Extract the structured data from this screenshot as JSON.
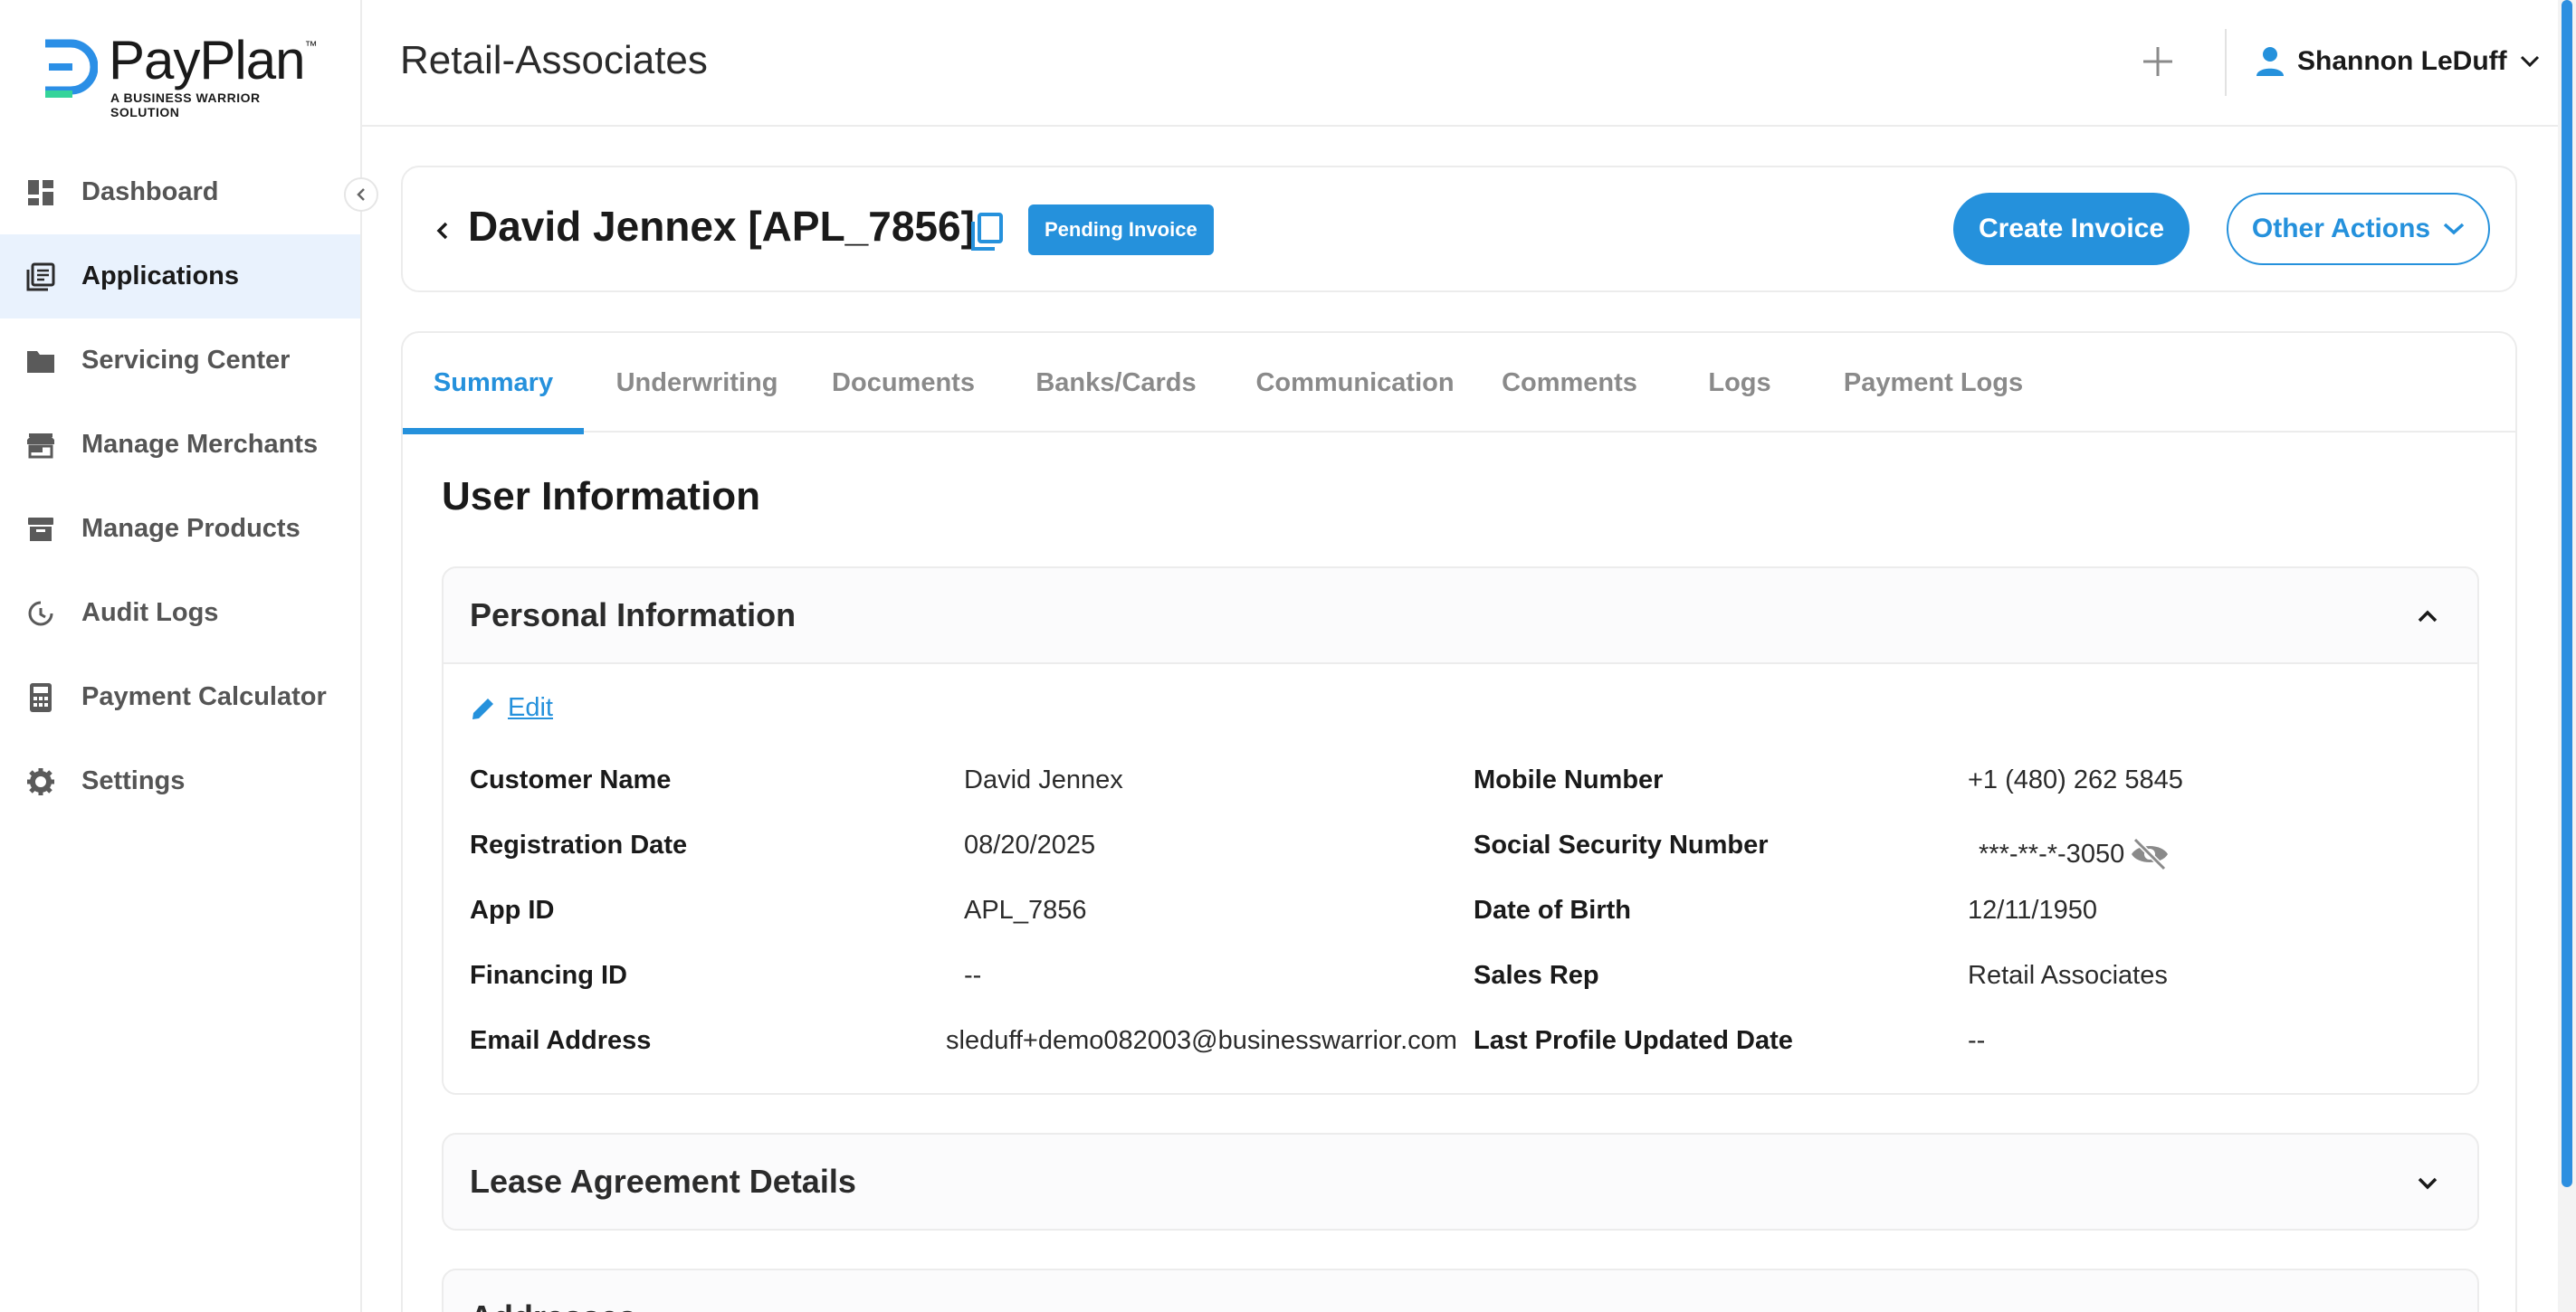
{
  "brand": {
    "name": "PayPlan",
    "trademark": "™",
    "tagline": "A BUSINESS WARRIOR SOLUTION"
  },
  "sidebar": {
    "items": [
      {
        "label": "Dashboard",
        "icon": "dashboard-icon",
        "active": false
      },
      {
        "label": "Applications",
        "icon": "applications-icon",
        "active": true
      },
      {
        "label": "Servicing Center",
        "icon": "folder-icon",
        "active": false
      },
      {
        "label": "Manage Merchants",
        "icon": "store-icon",
        "active": false
      },
      {
        "label": "Manage Products",
        "icon": "archive-icon",
        "active": false
      },
      {
        "label": "Audit Logs",
        "icon": "history-icon",
        "active": false
      },
      {
        "label": "Payment Calculator",
        "icon": "calculator-icon",
        "active": false
      },
      {
        "label": "Settings",
        "icon": "gear-icon",
        "active": false
      }
    ]
  },
  "header": {
    "title": "Retail-Associates",
    "user_name": "Shannon LeDuff"
  },
  "application": {
    "name": "David Jennex [APL_7856]",
    "status": "Pending Invoice",
    "create_invoice_label": "Create Invoice",
    "other_actions_label": "Other Actions"
  },
  "tabs": [
    {
      "label": "Summary",
      "active": true
    },
    {
      "label": "Underwriting",
      "active": false
    },
    {
      "label": "Documents",
      "active": false
    },
    {
      "label": "Banks/Cards",
      "active": false
    },
    {
      "label": "Communication",
      "active": false
    },
    {
      "label": "Comments",
      "active": false
    },
    {
      "label": "Logs",
      "active": false
    },
    {
      "label": "Payment Logs",
      "active": false
    }
  ],
  "summary": {
    "section_title": "User Information",
    "personal": {
      "title": "Personal Information",
      "edit_label": "Edit",
      "left_fields": [
        {
          "label": "Customer Name",
          "value": "David Jennex"
        },
        {
          "label": "Registration Date",
          "value": "08/20/2025"
        },
        {
          "label": "App ID",
          "value": "APL_7856"
        },
        {
          "label": "Financing ID",
          "value": "--"
        },
        {
          "label": "Email Address",
          "value": "sleduff+demo082003@businesswarrior.com"
        }
      ],
      "right_fields": [
        {
          "label": "Mobile Number",
          "value": "+1 (480) 262 5845"
        },
        {
          "label": "Social Security Number",
          "value": "***-**-*-3050"
        },
        {
          "label": "Date of Birth",
          "value": "12/11/1950"
        },
        {
          "label": "Sales Rep",
          "value": "Retail Associates"
        },
        {
          "label": "Last Profile Updated Date",
          "value": "--"
        }
      ]
    },
    "lease_title": "Lease Agreement Details",
    "addresses_title": "Addresses"
  },
  "colors": {
    "accent": "#2591dc",
    "active_nav_bg": "#e9f2fd",
    "logo_blue": "#2b8fe6",
    "logo_green": "#35d49a"
  }
}
